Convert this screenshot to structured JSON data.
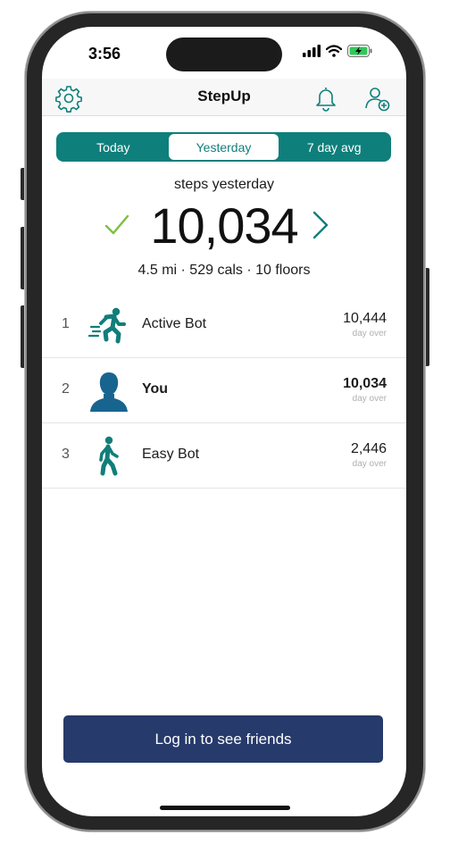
{
  "status": {
    "time": "3:56"
  },
  "nav": {
    "title": "StepUp"
  },
  "tabs": [
    {
      "label": "Today",
      "active": false
    },
    {
      "label": "Yesterday",
      "active": true
    },
    {
      "label": "7 day avg",
      "active": false
    }
  ],
  "summary": {
    "label": "steps yesterday",
    "steps": "10,034",
    "stats": "4.5 mi · 529 cals · 10 floors"
  },
  "leaderboard": [
    {
      "rank": "1",
      "name": "Active Bot",
      "value": "10,444",
      "sub": "day over",
      "icon": "running-icon"
    },
    {
      "rank": "2",
      "name": "You",
      "value": "10,034",
      "sub": "day over",
      "icon": "person-avatar-icon"
    },
    {
      "rank": "3",
      "name": "Easy Bot",
      "value": "2,446",
      "sub": "day over",
      "icon": "walking-icon"
    }
  ],
  "login_button": "Log in to see friends",
  "colors": {
    "accent": "#0f7f7b",
    "button": "#263a6b",
    "check": "#7cc043"
  }
}
